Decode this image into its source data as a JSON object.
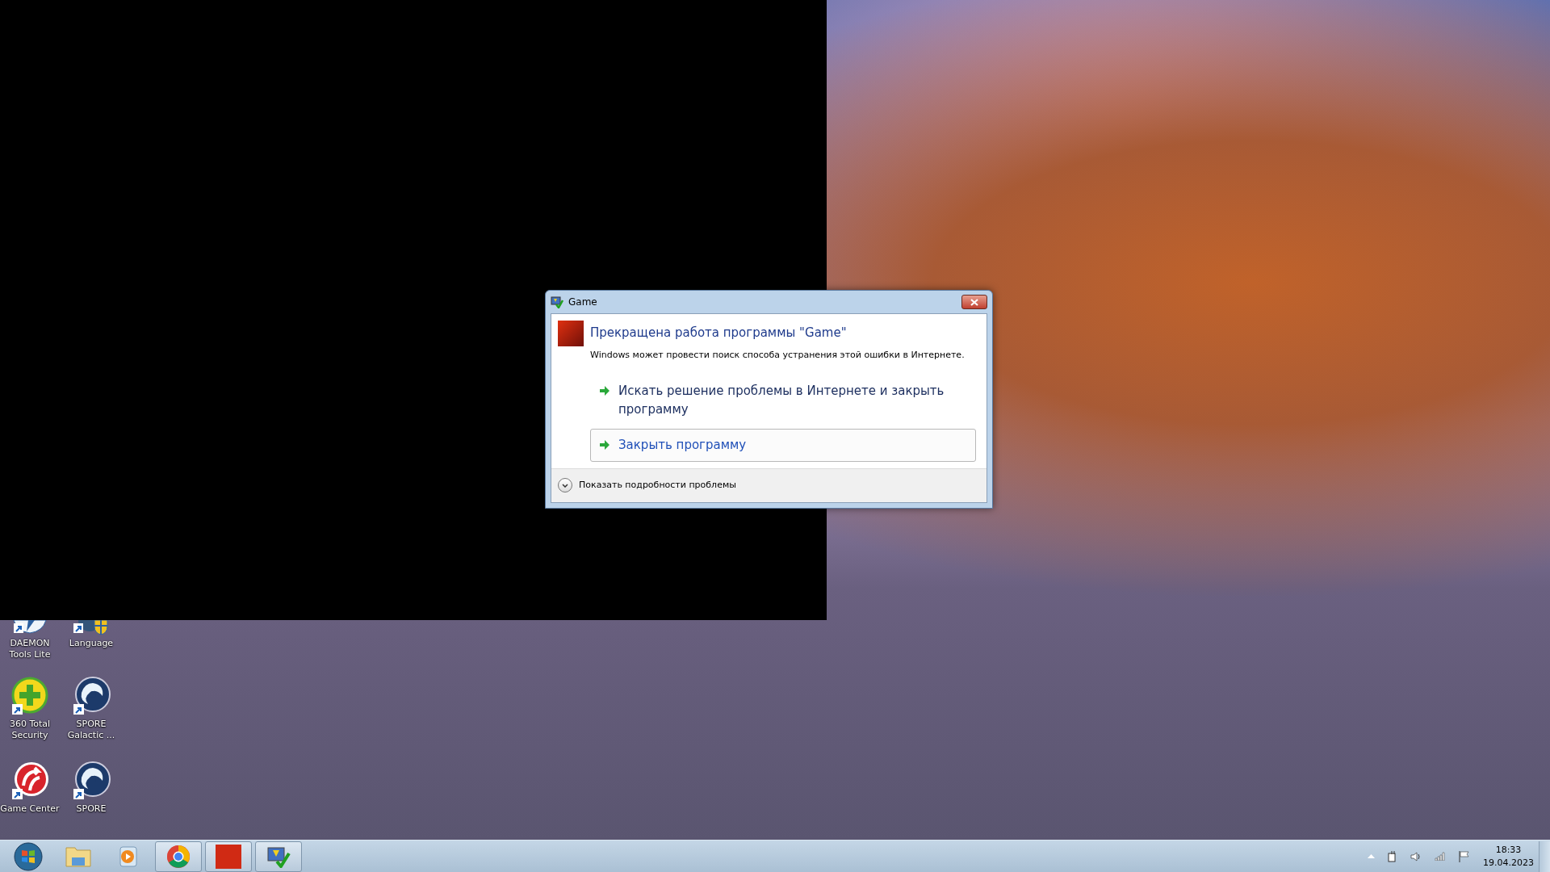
{
  "desktop_icons": [
    {
      "label": "DAEMON Tools Lite",
      "kind": "daemon"
    },
    {
      "label": "Language",
      "kind": "language"
    },
    {
      "label": "360 Total Security",
      "kind": "security"
    },
    {
      "label": "SPORE Galactic ...",
      "kind": "spore"
    },
    {
      "label": "Game Center",
      "kind": "gamecenter"
    },
    {
      "label": "SPORE",
      "kind": "spore"
    }
  ],
  "dialog": {
    "title": "Game",
    "heading": "Прекращена работа программы \"Game\"",
    "message": "Windows может провести поиск способа устранения этой ошибки в Интернете.",
    "options": [
      {
        "label": "Искать решение проблемы в Интернете и закрыть программу",
        "selected": false
      },
      {
        "label": "Закрыть программу",
        "selected": true
      }
    ],
    "details_toggle": "Показать подробности проблемы"
  },
  "taskbar": {
    "items": [
      {
        "kind": "start",
        "running": false
      },
      {
        "kind": "explorer",
        "running": false
      },
      {
        "kind": "media",
        "running": false
      },
      {
        "kind": "chrome",
        "running": true
      },
      {
        "kind": "game",
        "running": true
      },
      {
        "kind": "action_center",
        "running": true
      }
    ],
    "tray": {
      "time": "18:33",
      "date": "19.04.2023"
    }
  }
}
